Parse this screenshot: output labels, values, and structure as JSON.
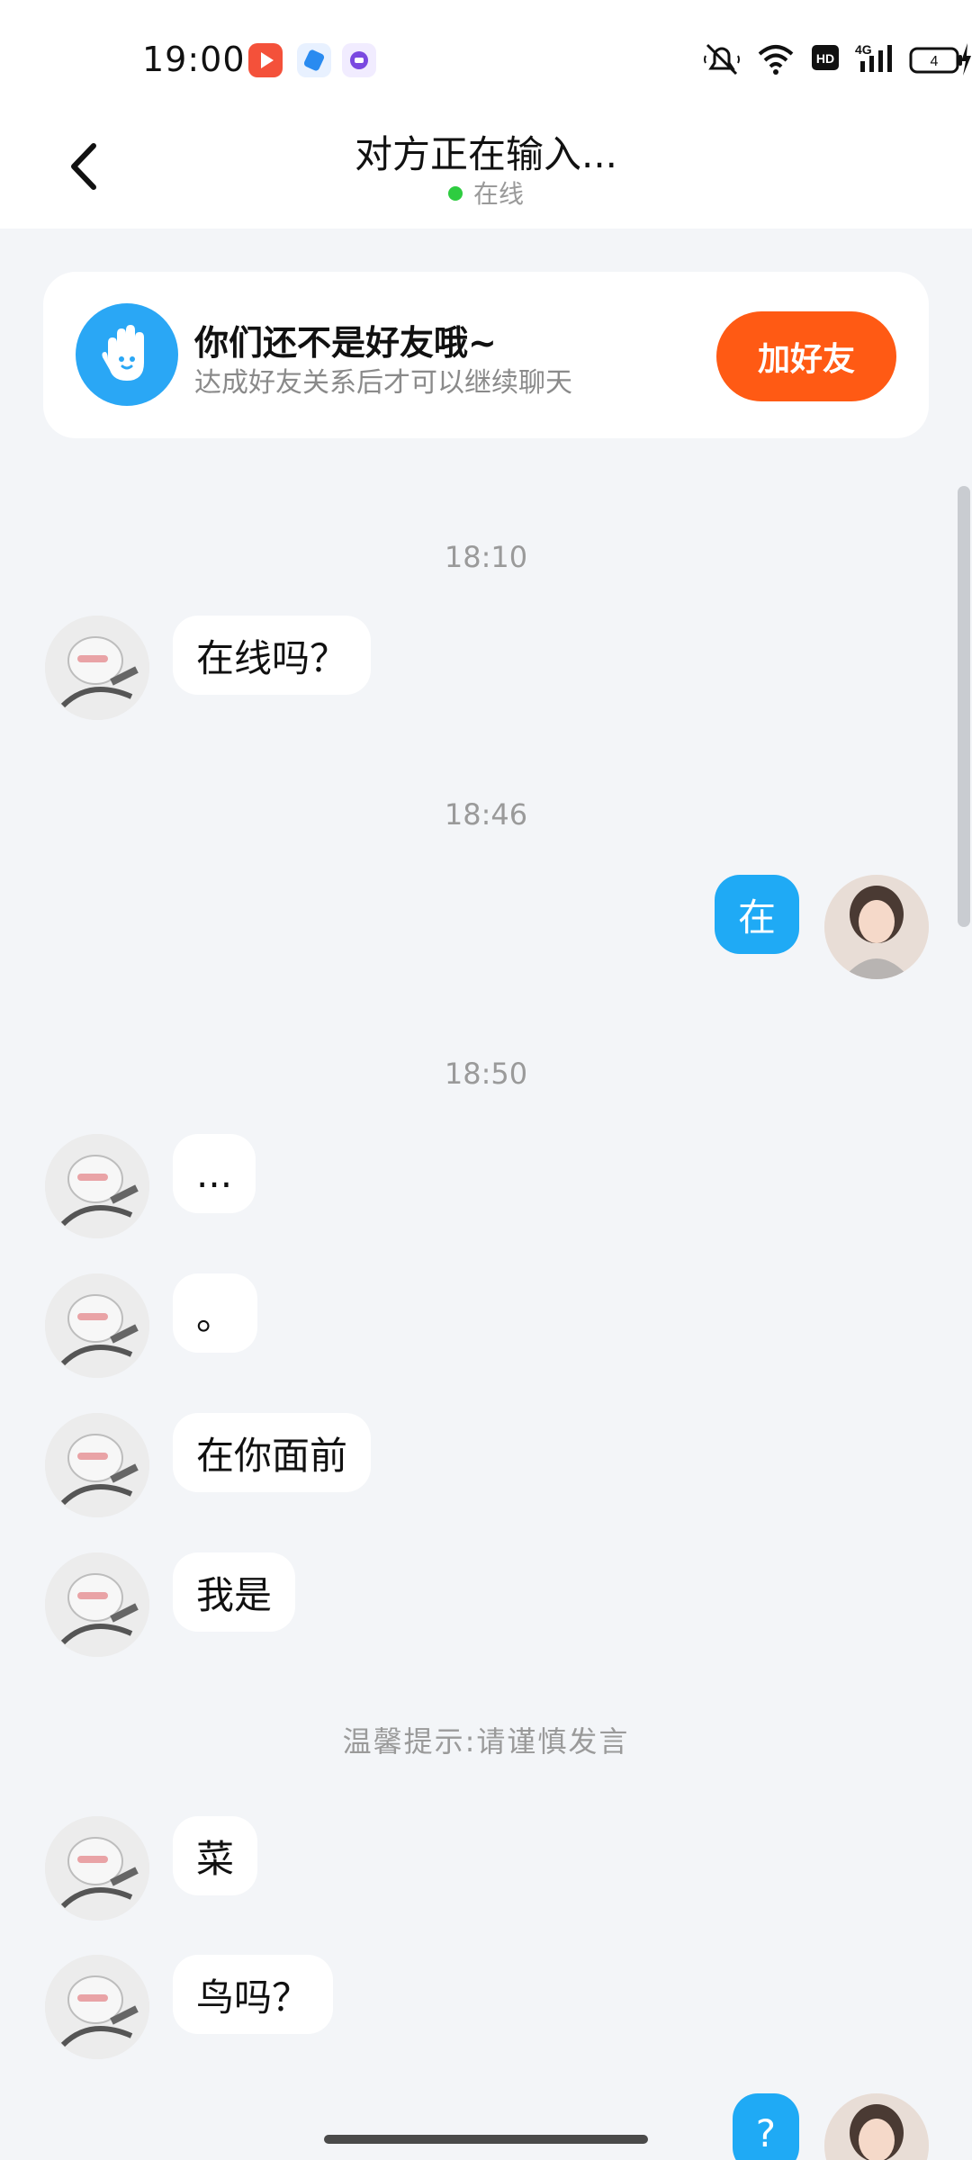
{
  "status_bar": {
    "time": "19:00",
    "signal_label": "4G",
    "battery_level": "4",
    "icons": [
      "mute-icon",
      "wifi-icon",
      "hd-icon",
      "signal-icon",
      "battery-icon",
      "charging-icon"
    ]
  },
  "header": {
    "title": "对方正在输入...",
    "status": "在线",
    "status_color": "#2ecc40"
  },
  "banner": {
    "title": "你们还不是好友哦~",
    "subtitle": "达成好友关系后才可以继续聊天",
    "button": "加好友",
    "icon": "hand-wave-icon",
    "button_color": "#ff5a14"
  },
  "chat": {
    "timestamps": [
      "18:10",
      "18:46",
      "18:50"
    ],
    "tip": "温馨提示:请谨慎发言",
    "messages": [
      {
        "side": "left",
        "text": "在线吗？"
      },
      {
        "side": "right",
        "text": "在"
      },
      {
        "side": "left",
        "text": "..."
      },
      {
        "side": "left",
        "text": "。"
      },
      {
        "side": "left",
        "text": "在你面前"
      },
      {
        "side": "left",
        "text": "我是"
      },
      {
        "side": "left",
        "text": "菜"
      },
      {
        "side": "left",
        "text": "鸟吗？"
      },
      {
        "side": "right",
        "text": "?"
      }
    ]
  },
  "colors": {
    "accent": "#1faaf5",
    "background": "#f3f5f8"
  }
}
